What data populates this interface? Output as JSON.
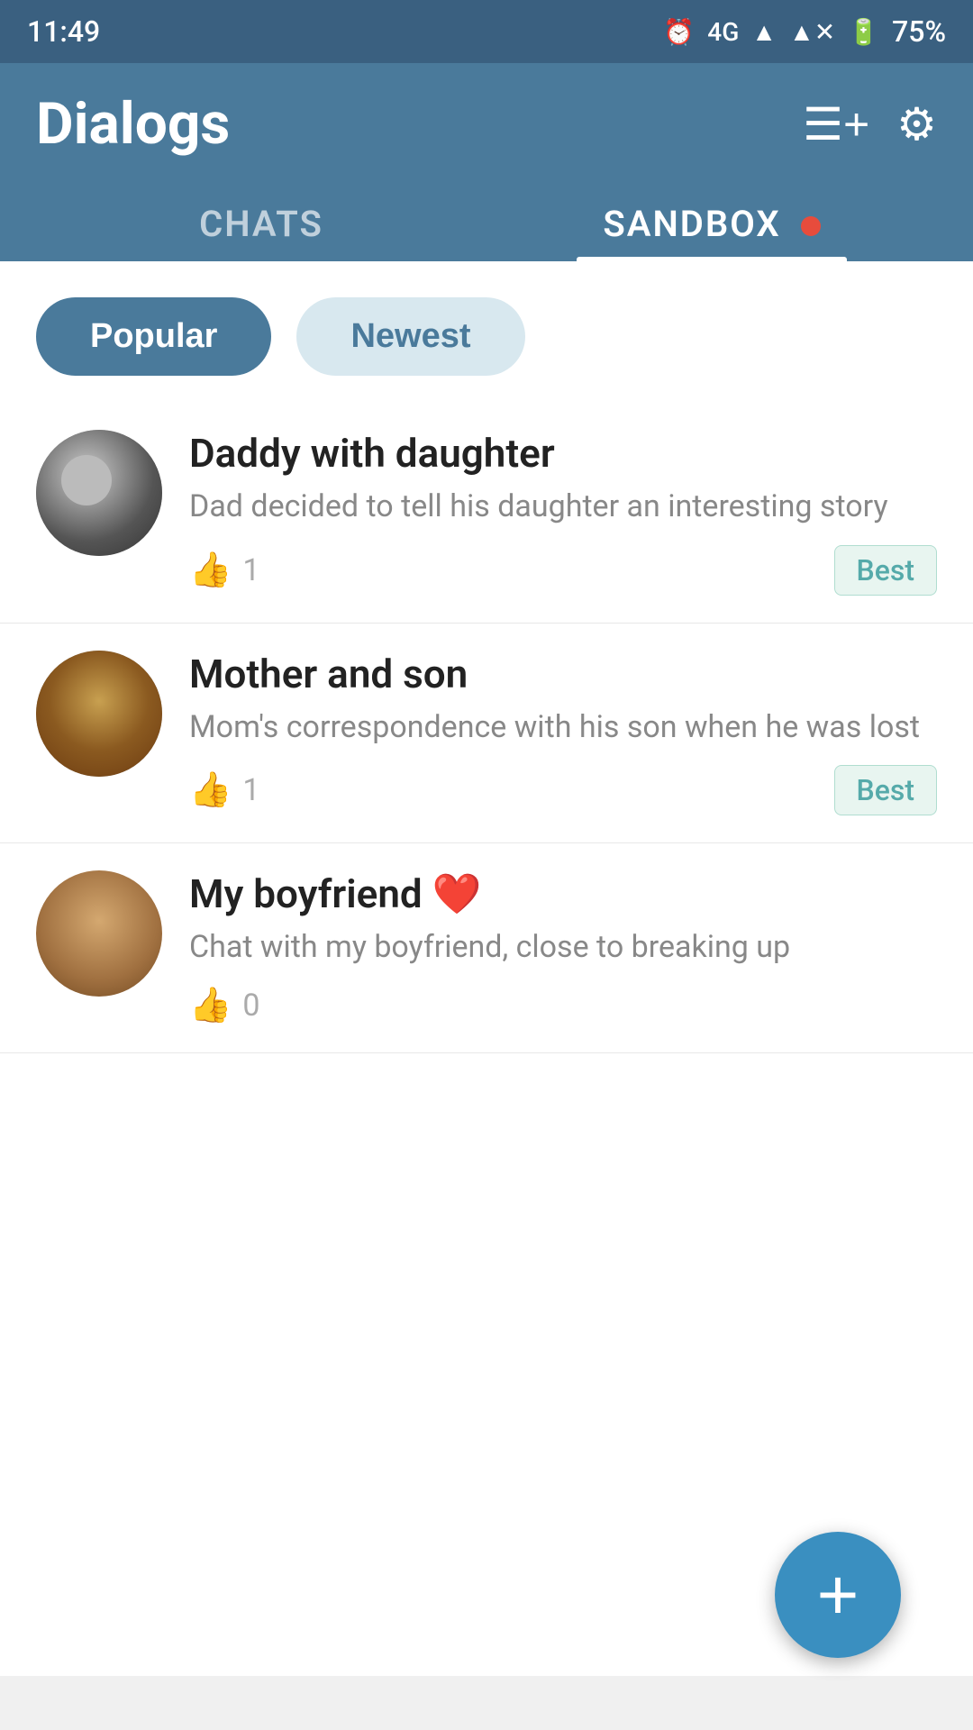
{
  "status_bar": {
    "time": "11:49",
    "battery": "75%",
    "network": "4G"
  },
  "header": {
    "title": "Dialogs",
    "new_chat_icon": "≡+",
    "settings_icon": "⚙"
  },
  "tabs": [
    {
      "id": "chats",
      "label": "CHATS",
      "active": false
    },
    {
      "id": "sandbox",
      "label": "SANDBOX",
      "active": true,
      "has_dot": true
    }
  ],
  "filters": [
    {
      "id": "popular",
      "label": "Popular",
      "active": true
    },
    {
      "id": "newest",
      "label": "Newest",
      "active": false
    }
  ],
  "chats": [
    {
      "id": 1,
      "title": "Daddy with daughter",
      "subtitle": "Dad decided to tell his daughter an interesting story",
      "likes": 1,
      "badge": "Best"
    },
    {
      "id": 2,
      "title": "Mother and son",
      "subtitle": "Mom's correspondence with his son when he was lost",
      "likes": 1,
      "badge": "Best"
    },
    {
      "id": 3,
      "title": "My boyfriend",
      "subtitle": "Chat with my boyfriend, close to breaking up",
      "likes": 0,
      "badge": null,
      "has_heart": true
    }
  ],
  "fab": {
    "label": "+"
  }
}
